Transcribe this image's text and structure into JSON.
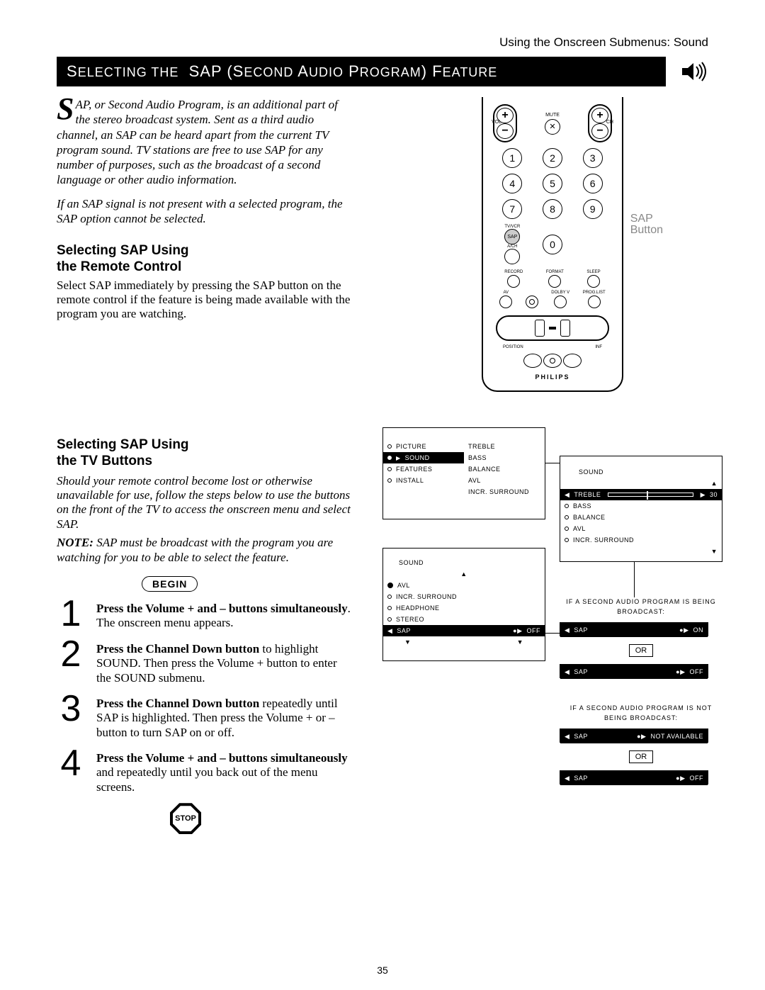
{
  "breadcrumb": "Using the Onscreen Submenus: Sound",
  "title": "SELECTING THE  SAP (SECOND AUDIO PROGRAM) FEATURE",
  "intro_dropcap": "S",
  "intro": "AP, or Second Audio Program, is an additional part of the stereo broadcast system. Sent as a third audio channel, an SAP can be heard apart from the current TV program sound. TV stations are free to use SAP for any number of purposes, such as the broadcast of a second language or other audio information.",
  "intro2": "If an SAP signal is not present with a selected program, the SAP option cannot be selected.",
  "remote_heading": "Selecting SAP Using the Remote Control",
  "remote_body": "Select SAP immediately by pressing the SAP button on the remote control if the feature is being made available with the program you are watching.",
  "tv_heading": "Selecting SAP Using the TV Buttons",
  "tv_body": "Should your remote control become lost or otherwise unavailable for use, follow the steps below to use the buttons on the front of the TV to access the onscreen menu and select SAP.",
  "tv_note_label": "NOTE:",
  "tv_note": " SAP must be broadcast with the program you are watching for you to be able to select the feature.",
  "begin": "BEGIN",
  "steps": {
    "1": {
      "bold": "Press the Volume + and – buttons simultaneously",
      "rest": ". The onscreen menu appears."
    },
    "2": {
      "bold": "Press the Channel Down button",
      "rest": " to highlight SOUND. Then press the Volume + button to enter the SOUND submenu."
    },
    "3": {
      "bold": "Press the Channel Down button",
      "rest": " repeatedly until SAP is highlighted. Then press the Volume + or – button to turn SAP on or off."
    },
    "4": {
      "bold": "Press the Volume + and – buttons simultaneously",
      "rest": " and repeatedly until you back out of the menu screens."
    }
  },
  "stop": "STOP",
  "remote": {
    "mute": "MUTE",
    "vol": "VOL",
    "ch": "CH",
    "keys": [
      "1",
      "2",
      "3",
      "4",
      "5",
      "6",
      "7",
      "8",
      "9",
      "0"
    ],
    "tv_vcr": "TV/VCR",
    "ach": "A/CH",
    "sap_label": "SAP",
    "sap_button": "Button",
    "row1": [
      "RECORD",
      "FORMAT",
      "SLEEP"
    ],
    "sap_txt": "SAP",
    "row2": [
      "AV",
      "",
      "DOLBY V",
      "PROG.LIST"
    ],
    "position": "POSITION",
    "inf": "INF",
    "brand": "PHILIPS"
  },
  "osd": {
    "main": {
      "left": [
        "PICTURE",
        "SOUND",
        "FEATURES",
        "INSTALL"
      ],
      "right": [
        "TREBLE",
        "BASS",
        "BALANCE",
        "AVL",
        "INCR. SURROUND"
      ]
    },
    "sound2": {
      "title": "SOUND",
      "items": [
        "AVL",
        "INCR. SURROUND",
        "HEADPHONE",
        "STEREO",
        "SAP"
      ],
      "sap_val": "OFF"
    },
    "detail": {
      "title": "SOUND",
      "items": [
        "TREBLE",
        "BASS",
        "BALANCE",
        "AVL",
        "INCR. SURROUND"
      ],
      "treble_val": "30"
    },
    "msg_on": "IF A SECOND AUDIO PROGRAM IS BEING BROADCAST:",
    "sap_on": {
      "label": "SAP",
      "val": "ON"
    },
    "or": "OR",
    "sap_off": {
      "label": "SAP",
      "val": "OFF"
    },
    "msg_na": "IF A SECOND AUDIO PROGRAM IS NOT BEING BROADCAST:",
    "sap_na": {
      "label": "SAP",
      "val": "NOT AVAILABLE"
    }
  },
  "page_number": "35"
}
